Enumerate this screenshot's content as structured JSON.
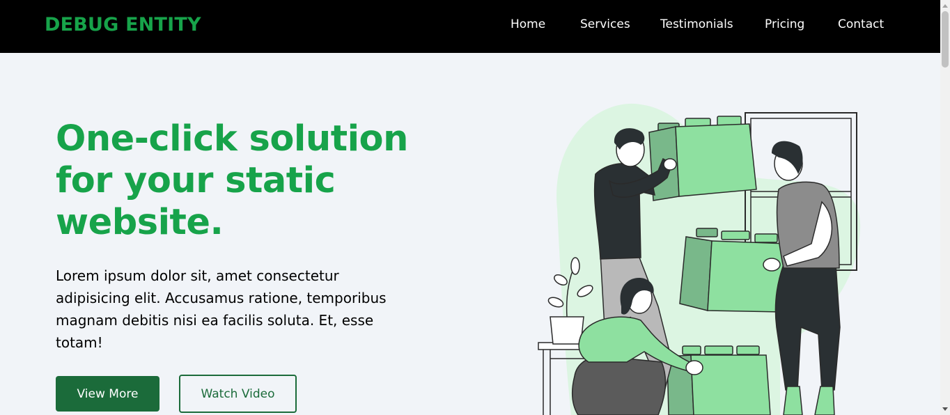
{
  "brand": {
    "name": "DEBUG ENTITY"
  },
  "nav": {
    "items": [
      {
        "label": "Home"
      },
      {
        "label": "Services"
      },
      {
        "label": "Testimonials"
      },
      {
        "label": "Pricing"
      },
      {
        "label": "Contact"
      }
    ]
  },
  "hero": {
    "title": "One-click solution for your static website.",
    "description": "Lorem ipsum dolor sit, amet consectetur adipisicing elit. Accusamus ratione, temporibus magnam debitis nisi ea facilis soluta. Et, esse totam!",
    "primary_button": "View More",
    "secondary_button": "Watch Video"
  },
  "colors": {
    "brand_green": "#17a34a",
    "button_green": "#1b6b3a",
    "nav_background": "#000000",
    "page_background": "#f1f4f8",
    "illustration_light_green": "#8ee0a0"
  },
  "icons": {
    "illustration": "team-building-blocks-illustration"
  }
}
